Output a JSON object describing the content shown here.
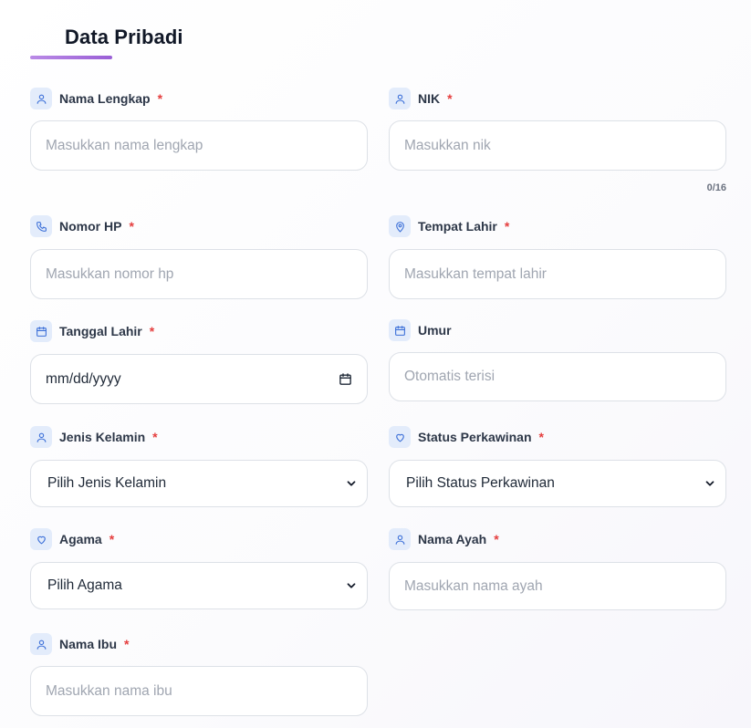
{
  "section": {
    "title": "Data Pribadi"
  },
  "fields": {
    "nama_lengkap": {
      "label": "Nama Lengkap",
      "required": "*",
      "placeholder": "Masukkan nama lengkap",
      "icon": "user-icon"
    },
    "nik": {
      "label": "NIK",
      "required": "*",
      "placeholder": "Masukkan nik",
      "counter": "0/16",
      "icon": "user-icon"
    },
    "nomor_hp": {
      "label": "Nomor HP",
      "required": "*",
      "placeholder": "Masukkan nomor hp",
      "icon": "phone-icon"
    },
    "tempat_lahir": {
      "label": "Tempat Lahir",
      "required": "*",
      "placeholder": "Masukkan tempat lahir",
      "icon": "map-pin-icon"
    },
    "tanggal_lahir": {
      "label": "Tanggal Lahir",
      "required": "*",
      "value": "mm/dd/yyyy",
      "icon": "calendar-icon"
    },
    "umur": {
      "label": "Umur",
      "placeholder": "Otomatis terisi",
      "icon": "calendar-icon"
    },
    "jenis_kelamin": {
      "label": "Jenis Kelamin",
      "required": "*",
      "value": "Pilih Jenis Kelamin",
      "icon": "user-icon"
    },
    "status_perkawinan": {
      "label": "Status Perkawinan",
      "required": "*",
      "value": "Pilih Status Perkawinan",
      "icon": "heart-icon"
    },
    "agama": {
      "label": "Agama",
      "required": "*",
      "value": "Pilih Agama",
      "icon": "heart-icon"
    },
    "nama_ayah": {
      "label": "Nama Ayah",
      "required": "*",
      "placeholder": "Masukkan nama ayah",
      "icon": "user-icon"
    },
    "nama_ibu": {
      "label": "Nama Ibu",
      "required": "*",
      "placeholder": "Masukkan nama ibu",
      "icon": "user-icon"
    }
  },
  "colors": {
    "accent": "#9a5fd6",
    "required": "#e53e3e",
    "icon_bg": "#e3ecfb",
    "icon_stroke": "#3b6fd8"
  }
}
